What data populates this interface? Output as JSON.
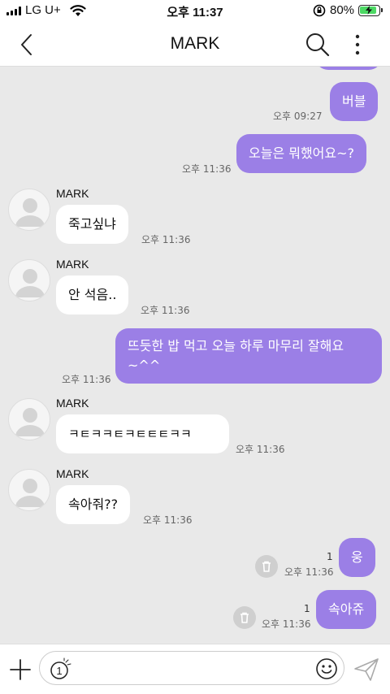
{
  "status_bar": {
    "carrier": "LG U+",
    "time": "오후 11:37",
    "battery_percent": "80%",
    "icons": [
      "signal-icon",
      "wifi-icon",
      "orientation-lock-icon",
      "battery-charging-icon"
    ]
  },
  "header": {
    "title": "MARK",
    "icons": [
      "back-chevron-icon",
      "search-icon",
      "more-vertical-icon"
    ]
  },
  "messages": [
    {
      "from": "me",
      "text": "",
      "partial": true
    },
    {
      "from": "me",
      "text": "버블",
      "time": "오후 09:27"
    },
    {
      "from": "me",
      "text": "오늘은 뭐했어요~?",
      "time": "오후 11:36"
    },
    {
      "from": "them",
      "sender": "MARK",
      "text": "죽고싶냐",
      "time": "오후 11:36"
    },
    {
      "from": "them",
      "sender": "MARK",
      "text": "안 석음..",
      "time": "오후 11:36"
    },
    {
      "from": "me",
      "text": "뜨듯한 밥 먹고 오늘 하루 마무리 잘해요~^^",
      "time": "오후 11:36"
    },
    {
      "from": "them",
      "sender": "MARK",
      "text": "ㅋㅌㅋㅋㅌㅋㅌㅌㅌㅋㅋ",
      "time": "오후 11:36"
    },
    {
      "from": "them",
      "sender": "MARK",
      "text": "속아줘??",
      "time": "오후 11:36"
    },
    {
      "from": "me",
      "text": "웅",
      "time": "오후 11:36",
      "unread": "1",
      "failed": true
    },
    {
      "from": "me",
      "text": "속아쥬",
      "time": "오후 11:36",
      "unread": "1",
      "failed": true
    }
  ],
  "input_bar": {
    "value": "",
    "timer_label": "1",
    "icons": [
      "plus-icon",
      "timer-icon",
      "emoji-icon",
      "send-icon"
    ]
  },
  "colors": {
    "my_bubble": "#9b7fe6",
    "their_bubble": "#ffffff",
    "chat_background": "#e9e9e9",
    "battery_charge": "#4cd964"
  }
}
